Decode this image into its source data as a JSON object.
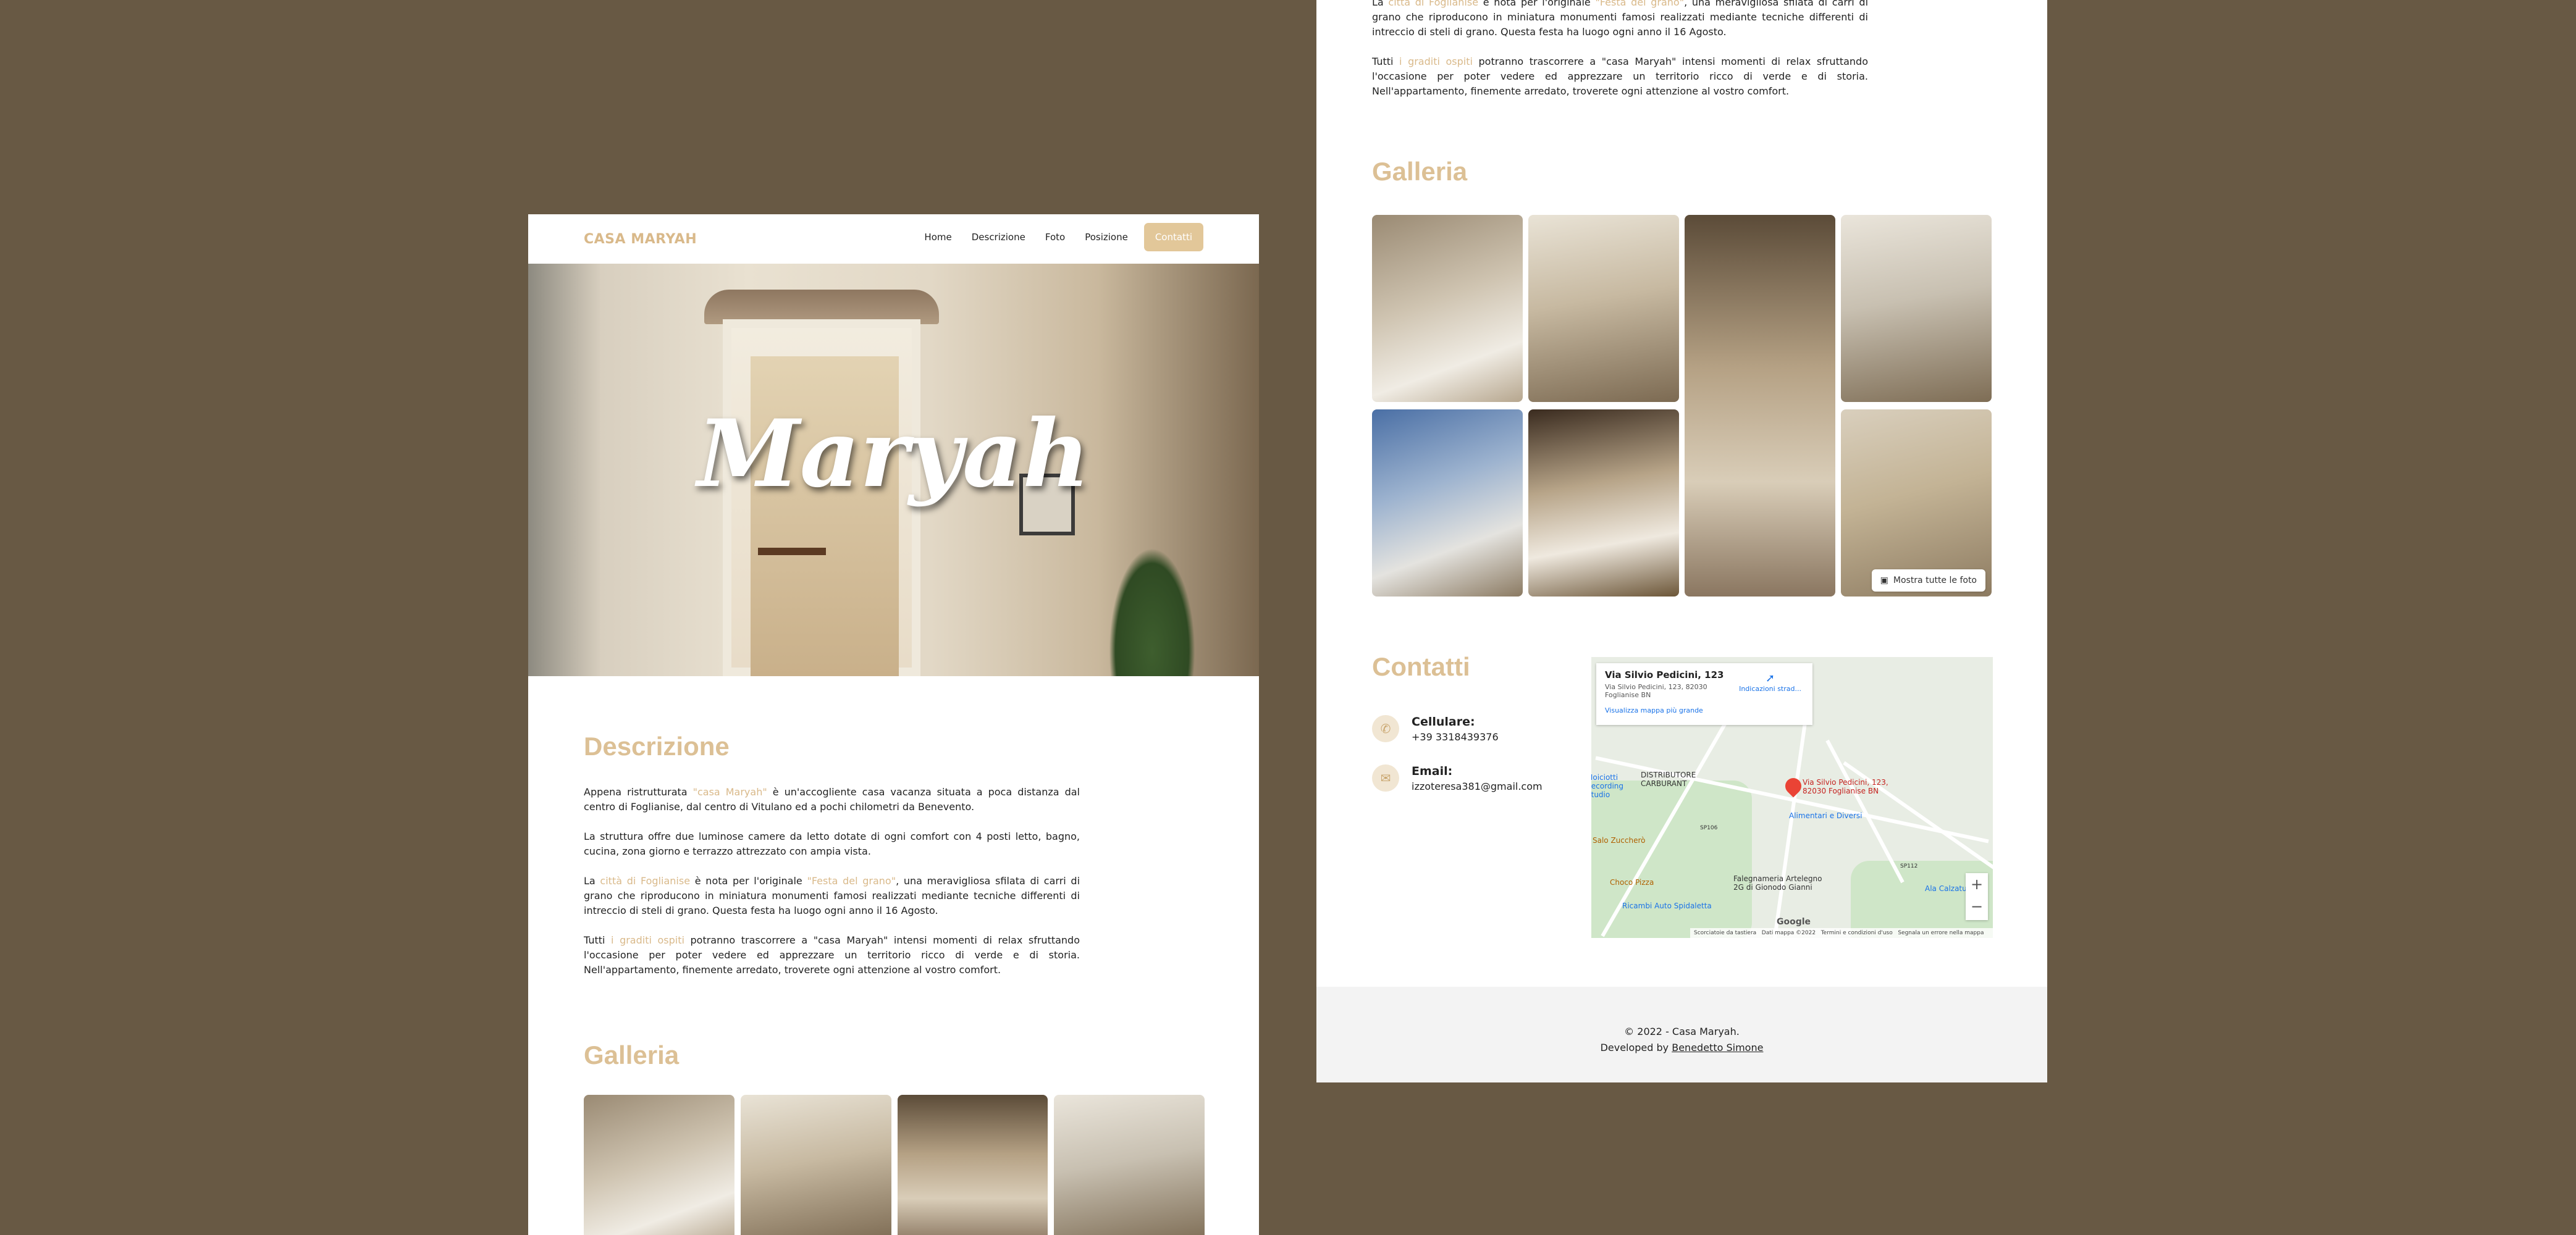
{
  "nav": {
    "brand": "CASA MARYAH",
    "items": [
      "Home",
      "Descrizione",
      "Foto",
      "Posizione"
    ],
    "cta": "Contatti"
  },
  "hero": {
    "title": "Maryah"
  },
  "descrizione": {
    "heading": "Descrizione",
    "p1": {
      "pre": "Appena ristrutturata ",
      "hl": "\"casa Maryah\"",
      "post": " è un'accogliente casa vacanza situata a poca distanza dal centro di Foglianise, dal centro di Vitulano ed a pochi chilometri da Benevento."
    },
    "p2": "La struttura offre due luminose camere da letto dotate di ogni comfort con 4 posti letto, bagno, cucina, zona giorno e terrazzo attrezzato con ampia vista.",
    "p3": {
      "pre": "La ",
      "hl1": "città di Foglianise",
      "mid": " è nota per l'originale ",
      "hl2": "\"Festa del grano\"",
      "post": ", una meravigliosa sfilata di carri di grano che riproducono in miniatura monumenti famosi realizzati mediante tecniche differenti di intreccio di steli di grano. Questa festa ha luogo ogni anno il 16 Agosto."
    },
    "p4": {
      "pre": "Tutti ",
      "hl": "i graditi ospiti",
      "post": " potranno trascorrere a \"casa Maryah\" intensi momenti di relax sfruttando l'occasione per poter vedere ed apprezzare un territorio ricco di verde e di storia. Nell'appartamento, finemente arredato, troverete ogni attenzione al vostro comfort."
    }
  },
  "galleria": {
    "heading": "Galleria",
    "show_all": "Mostra tutte le foto"
  },
  "contatti": {
    "heading": "Contatti",
    "phone_label": "Cellulare:",
    "phone": "+39 3318439376",
    "email_label": "Email:",
    "email": "izzoteresa381@gmail.com"
  },
  "map": {
    "place_title": "Via Silvio Pedicini, 123",
    "place_address": "Via Silvio Pedicini, 123, 82030 Foglianise BN",
    "directions": "Indicazioni strad...",
    "larger_map": "Visualizza mappa più grande",
    "pin_label": "Via Silvio Pedicini, 123, 82030 Foglianise BN",
    "labels": [
      "DISTRIBUTORE CARBURANT",
      "Alimentari e Diversi",
      "Salo Zuccherò",
      "Choco Pizza",
      "Falegnameria Artelegno 2G di Gionodo Gianni",
      "Ricambi Auto Spidaletta",
      "Ala Calzature",
      "Moiciotti Recording Studio",
      "SP106",
      "SP112"
    ],
    "google": "Google",
    "attribution": [
      "Scorciatoie da tastiera",
      "Dati mappa ©2022",
      "Termini e condizioni d'uso",
      "Segnala un errore nella mappa"
    ]
  },
  "footer": {
    "copy": "© 2022 - Casa Maryah.",
    "dev_prefix": "Developed by ",
    "dev_name": "Benedetto Simone"
  },
  "colors": {
    "background": "#685944",
    "accent": "#d9b98a",
    "heading": "#dcc095",
    "footer": "#f3f3f3"
  }
}
